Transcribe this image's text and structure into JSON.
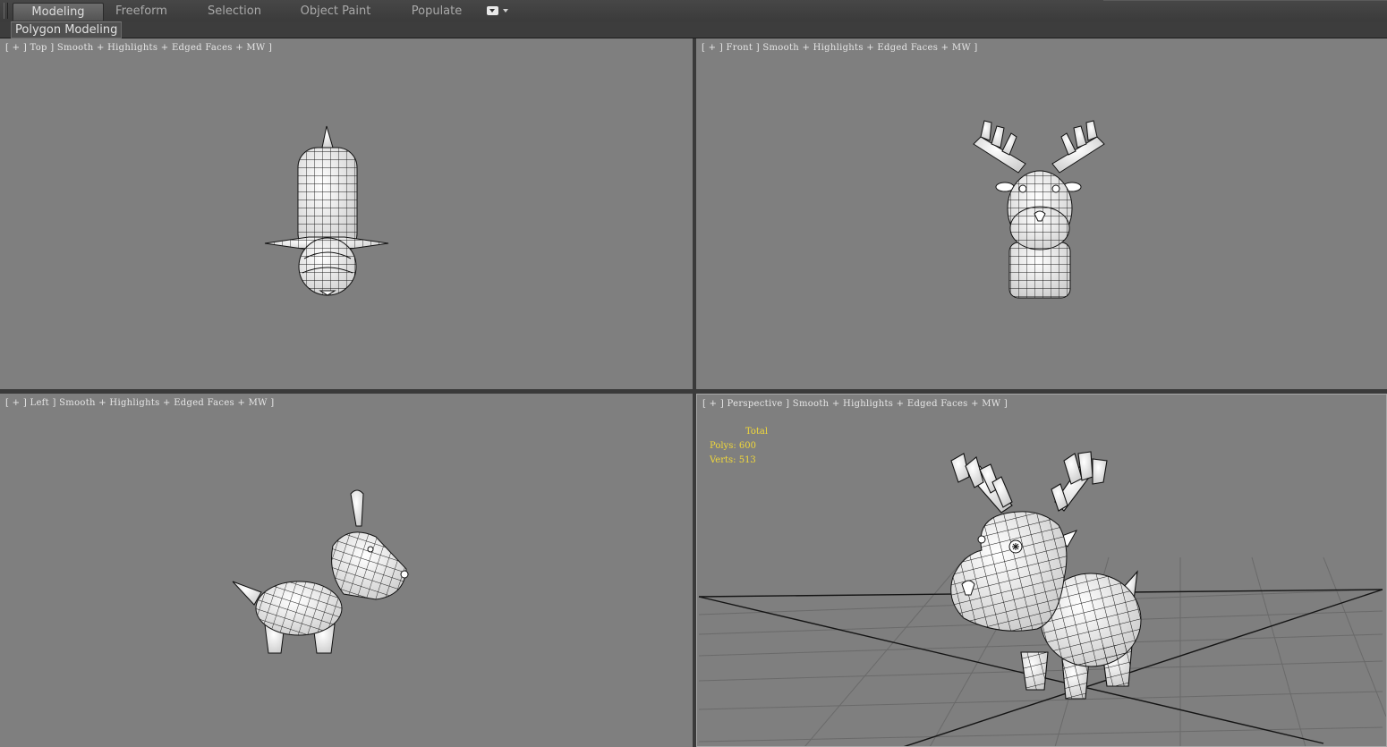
{
  "ribbon": {
    "tabs": [
      {
        "label": "Modeling",
        "active": true
      },
      {
        "label": "Freeform",
        "active": false
      },
      {
        "label": "Selection",
        "active": false
      },
      {
        "label": "Object Paint",
        "active": false
      },
      {
        "label": "Populate",
        "active": false
      }
    ],
    "menu_icon": "dropdown-menu-icon"
  },
  "panel": {
    "label": "Polygon Modeling"
  },
  "viewports": {
    "top": {
      "label": "[ + ] Top ] Smooth + Highlights + Edged Faces + MW ]"
    },
    "front": {
      "label": "[ + ] Front ] Smooth + Highlights + Edged Faces + MW ]"
    },
    "left": {
      "label": "[ + ] Left ] Smooth + Highlights + Edged Faces + MW ]"
    },
    "perspective": {
      "label": "[ + ] Perspective ] Smooth + Highlights + Edged Faces + MW ]",
      "stats": {
        "total_label": "Total",
        "polys": "Polys: 600",
        "verts": "Verts: 513"
      }
    }
  },
  "colors": {
    "viewport_bg": "#7f7f7f",
    "stats_text": "#f1d83a",
    "ui_bg": "#3a3a3a"
  }
}
